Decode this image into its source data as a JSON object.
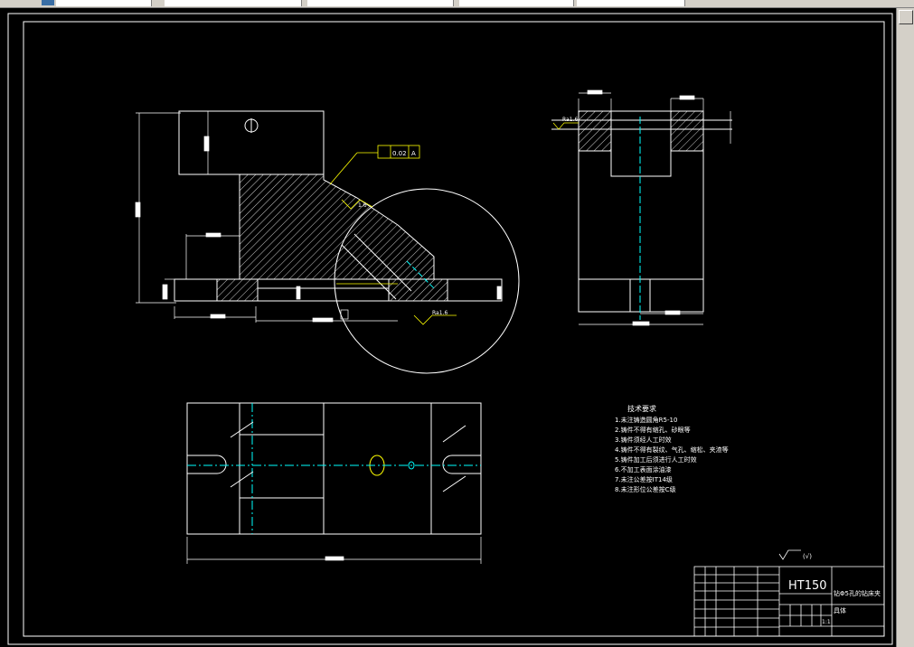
{
  "window": {
    "tabs": [
      "",
      "",
      "",
      "",
      ""
    ]
  },
  "tech_notes": {
    "title": "技术要求",
    "items": [
      "1.未注铸造圆角R5-10",
      "2.铸件不得有缩孔、砂眼等",
      "3.铸件须经人工时效",
      "4.铸件不得有裂纹、气孔、缩松、夹渣等",
      "5.铸件加工后须进行人工时效",
      "6.不加工表面涂油漆",
      "7.未注公差按IT14级",
      "8.未注形位公差按C级"
    ]
  },
  "title_block": {
    "material": "HT150",
    "part_name_1": "钻Φ5孔的钻床夹",
    "part_name_2": "具体",
    "scale": "1:1",
    "roughness_note": "(√)"
  },
  "annotations": {
    "ra_side": "Ra1.6",
    "ra_bottom": "Ra1.6",
    "ra_incline": "1.6",
    "tol_frame": "0.02",
    "datum": "A"
  },
  "colors": {
    "line": "#ffffff",
    "center": "#00ffff",
    "leader": "#ffff00"
  }
}
